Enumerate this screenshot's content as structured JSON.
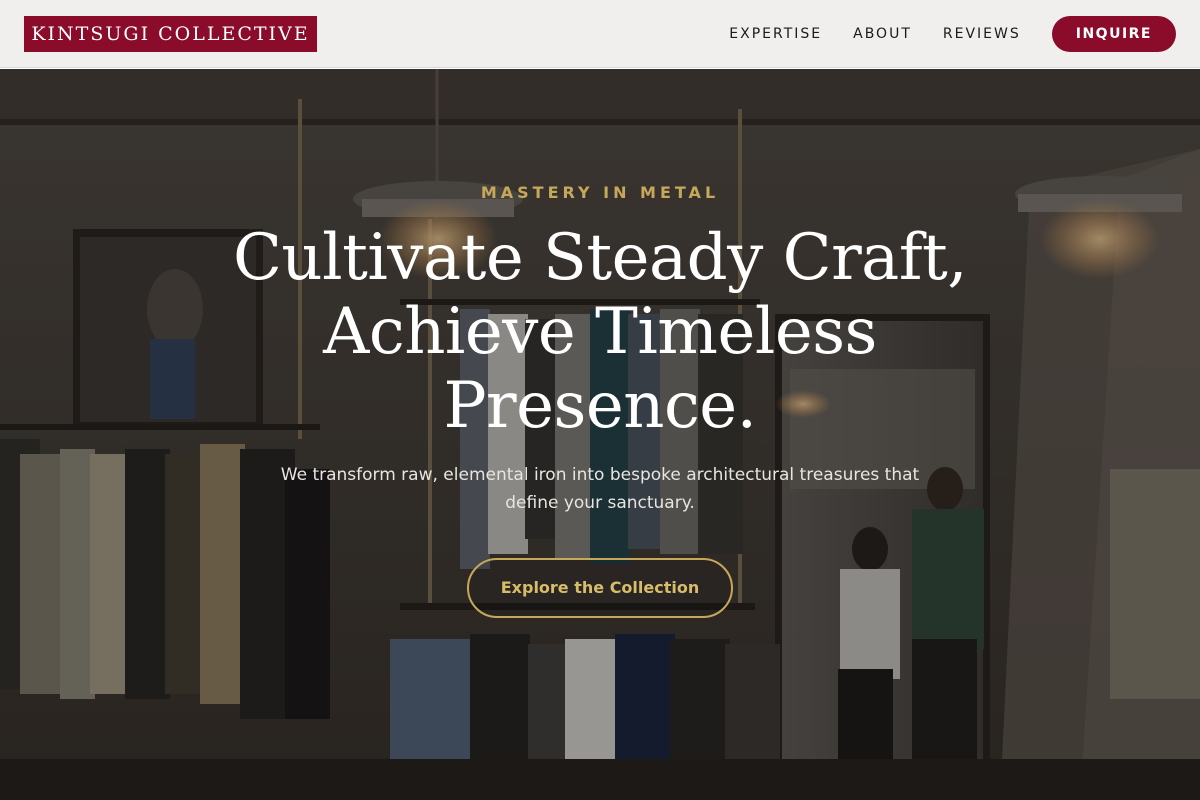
{
  "header": {
    "logo_text": "KINTSUGI COLLECTIVE",
    "nav": [
      {
        "label": "EXPERTISE"
      },
      {
        "label": "ABOUT"
      },
      {
        "label": "REVIEWS"
      }
    ],
    "cta_label": "INQUIRE"
  },
  "hero": {
    "eyebrow": "MASTERY IN METAL",
    "headline_lines": [
      "Cultivate Steady Craft,",
      "Achieve Timeless",
      "Presence."
    ],
    "subtext_lines": [
      "We transform raw, elemental iron into bespoke architectural treasures that",
      "define your sanctuary."
    ],
    "cta_label": "Explore the Collection"
  },
  "colors": {
    "brand": "#8a0b2a",
    "gold": "#c7a85a",
    "header_bg": "#f0efed"
  }
}
